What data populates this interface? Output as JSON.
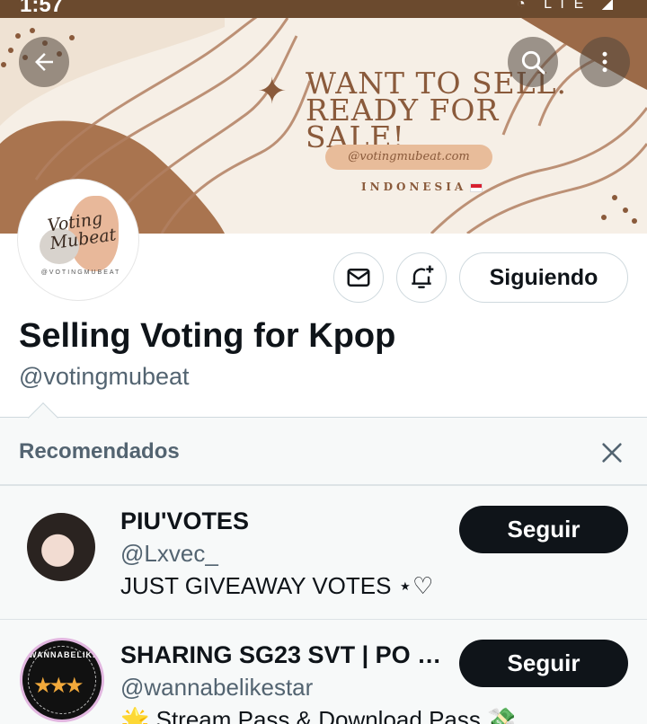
{
  "status_bar": {
    "time": "1:57",
    "icons": "◔ LTE ◢"
  },
  "banner": {
    "headline_line1": "WANT TO SELL.",
    "headline_line2": "READY FOR SALE!",
    "sparkle": "✦",
    "website": "@votingmubeat.com",
    "country": "INDONESIA",
    "colors": {
      "background": "#f6efe6",
      "brown": "#8a5a3b",
      "pill": "#e8bc9a"
    }
  },
  "header_icons": {
    "back": "back-arrow-icon",
    "search": "search-icon",
    "more": "more-vertical-icon"
  },
  "avatar": {
    "script_text": "Voting Mubeat",
    "mini_handle": "@VOTINGMUBEAT"
  },
  "actions": {
    "message_icon": "mail-icon",
    "notify_icon": "bell-plus-icon",
    "follow_label": "Siguiendo"
  },
  "profile": {
    "name": "Selling Voting for Kpop",
    "handle": "@votingmubeat"
  },
  "recommendations": {
    "title": "Recomendados",
    "close_icon": "close-icon",
    "users": [
      {
        "name": "PIU'VOTES",
        "handle": "@Lxvec_",
        "bio": "JUST GIVEAWAY VOTES ⋆♡",
        "button": "Seguir"
      },
      {
        "name": "SHARING SG23 SVT | PO …",
        "handle": "@wannabelikestar",
        "bio": "🌟 Stream Pass & Download Pass 💸",
        "button": "Seguir",
        "avatar_text": "WANNABELIKE"
      }
    ]
  },
  "colors": {
    "text": "#0f1419",
    "secondary": "#536471",
    "border": "#cfd9de",
    "reco_bg": "#f7f9f9"
  }
}
